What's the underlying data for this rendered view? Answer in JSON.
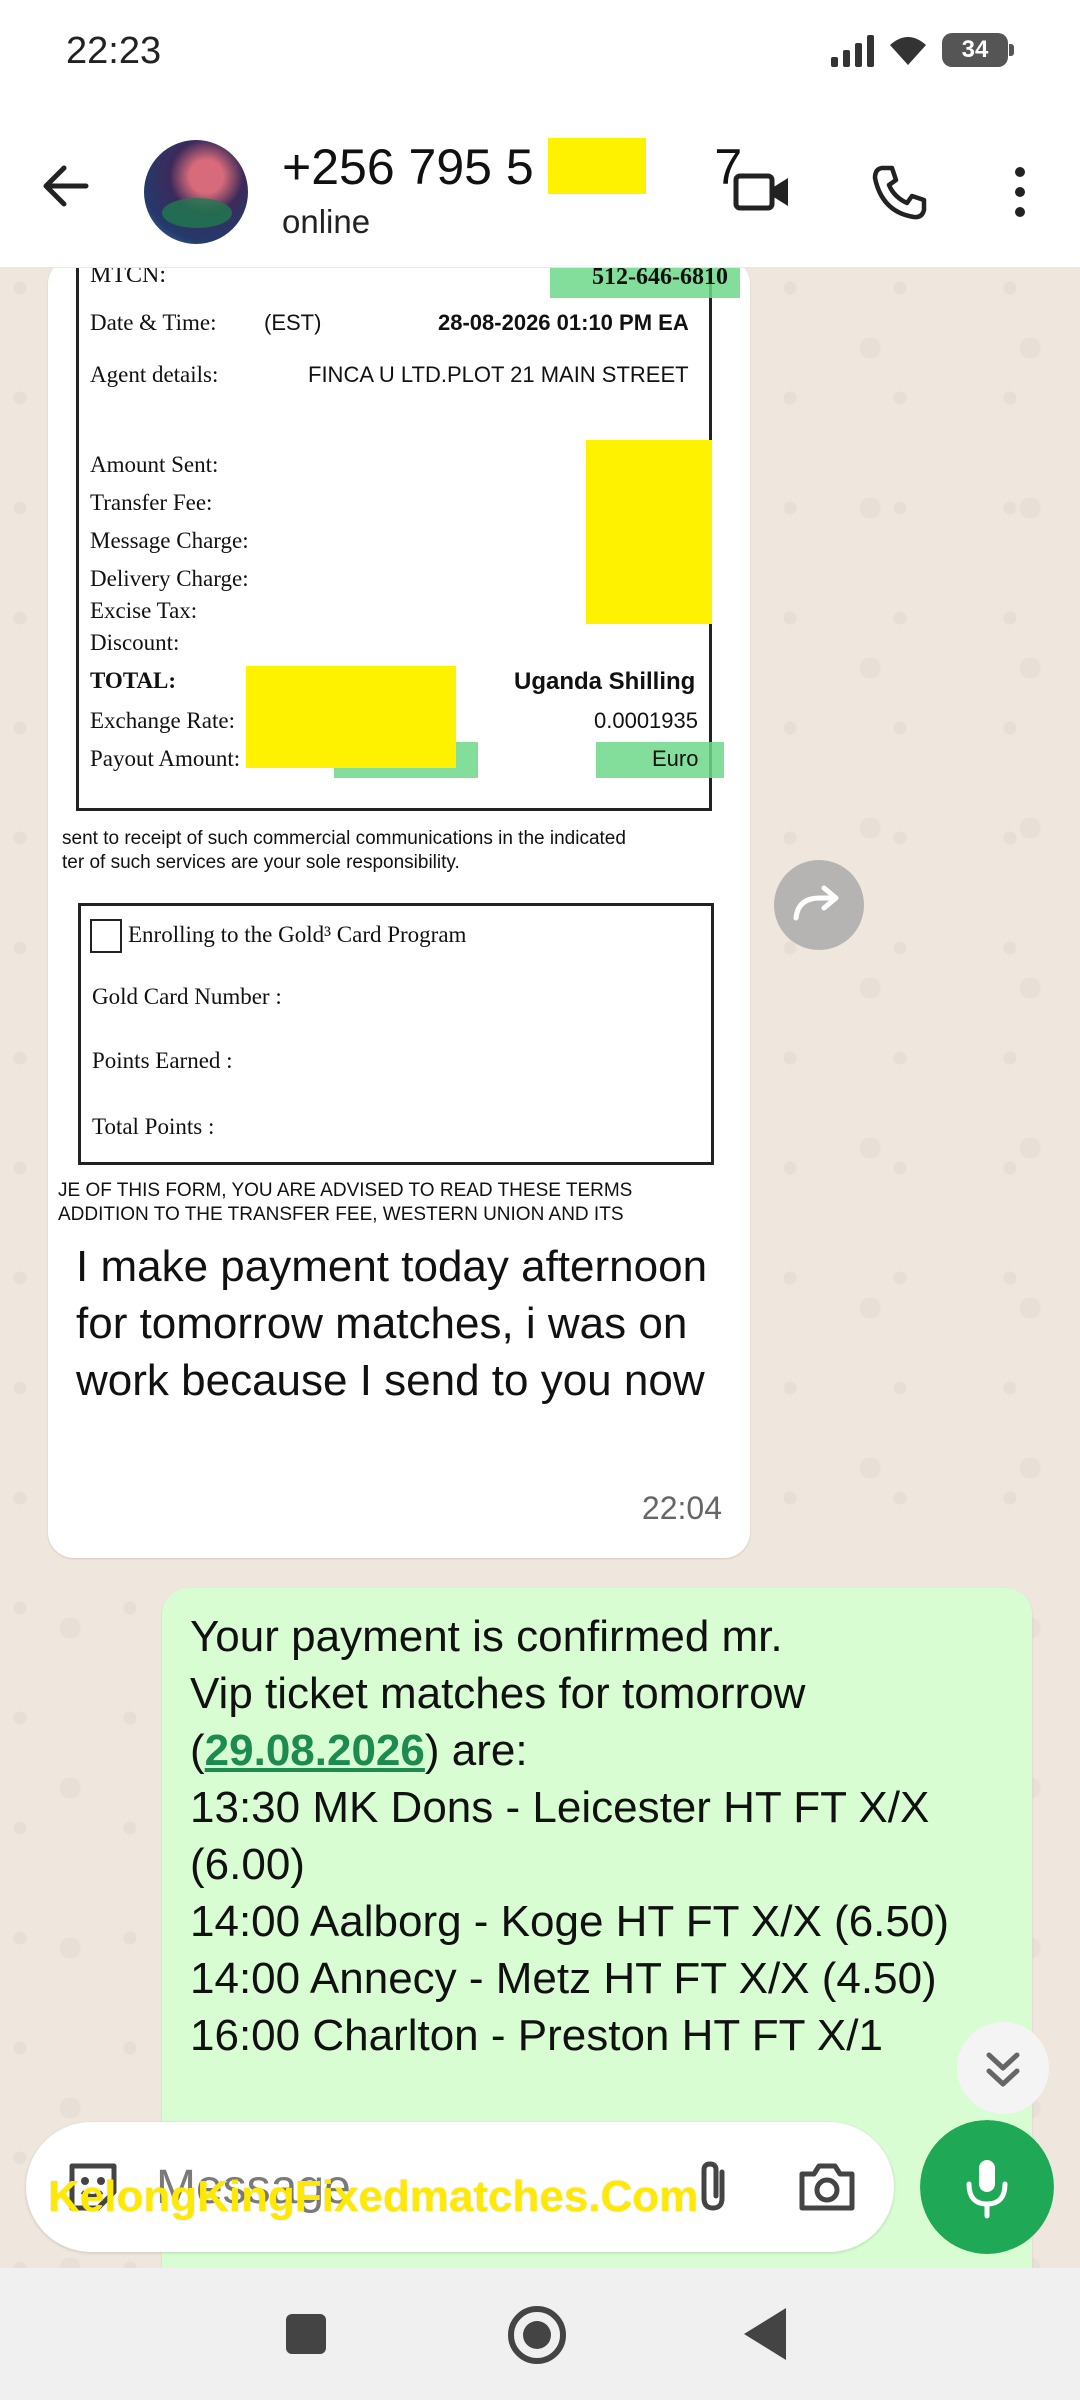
{
  "status_bar": {
    "time": "22:23",
    "battery": "34"
  },
  "header": {
    "contact_name": "+256 795 5       7",
    "contact_status": "online"
  },
  "receipt": {
    "mtcn_label": "MTCN:",
    "mtcn_value": "512-646-6810",
    "datetime_label": "Date & Time:",
    "datetime_zone": "(EST)",
    "datetime_value": "28-08-2026 01:10 PM EA",
    "agent_label": "Agent details:",
    "agent_value": "FINCA U LTD.PLOT 21 MAIN STREET",
    "amount_sent_label": "Amount Sent:",
    "transfer_fee_label": "Transfer Fee:",
    "message_charge_label": "Message Charge:",
    "delivery_charge_label": "Delivery Charge:",
    "excise_tax_label": "Excise Tax:",
    "discount_label": "Discount:",
    "total_label": "TOTAL:",
    "currency_value": "Uganda Shilling",
    "exchange_label": "Exchange Rate:",
    "exchange_value": "0.0001935",
    "payout_label": "Payout Amount:",
    "payout_currency": "Euro",
    "notice_line1": "sent to receipt of such commercial communications in the indicated",
    "notice_line2": "ter of such services are your sole responsibility.",
    "gold_enroll": "Enrolling to the Gold³ Card Program",
    "gold_number_label": "Gold Card Number :",
    "points_earned_label": "Points Earned :",
    "total_points_label": "Total Points :",
    "footer_line1": "JE OF THIS FORM, YOU ARE ADVISED TO READ THESE TERMS",
    "footer_line2": "ADDITION TO THE TRANSFER FEE, WESTERN UNION AND ITS"
  },
  "incoming_message": {
    "text": "I make payment today afternoon for tomorrow matches, i was on work because I send to you now",
    "time": "22:04"
  },
  "outgoing_message": {
    "line1": "Your payment is confirmed mr.",
    "line2": "Vip ticket matches for tomorrow",
    "date_open": "(",
    "date": "29.08.2026",
    "date_close": ") are:",
    "matches": "13:30 MK Dons - Leicester HT FT X/X (6.00)\n14:00 Aalborg - Koge HT FT X/X (6.50)\n14:00 Annecy - Metz HT FT X/X (4.50)\n16:00 Charlton - Preston HT FT X/1"
  },
  "input": {
    "placeholder": "Message"
  },
  "watermark": "KelongKingFixedmatches.Com",
  "colors": {
    "accent": "#1fa855",
    "outgoing_bubble": "#d8fdd2",
    "chat_bg": "#efe7dd",
    "redaction": "#fff200"
  }
}
